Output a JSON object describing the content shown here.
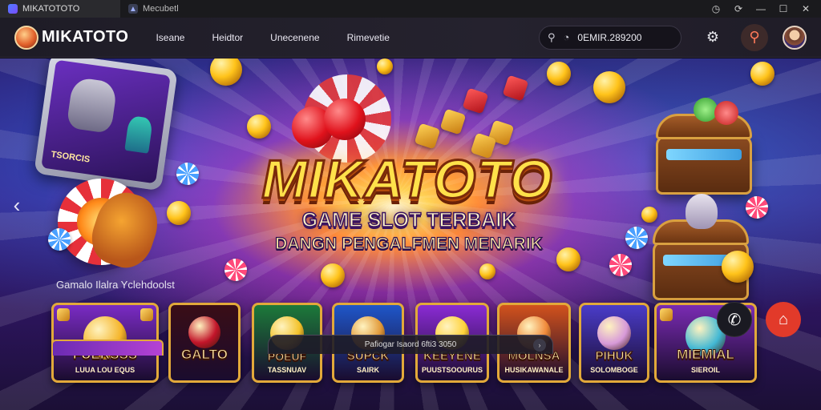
{
  "window": {
    "tabs": [
      {
        "label": "MIKATOTOTO",
        "active": true
      },
      {
        "label": "Mecubetl",
        "active": false
      }
    ],
    "controls": [
      "history-icon",
      "sync-icon",
      "minimize-icon",
      "maximize-icon",
      "close-icon"
    ]
  },
  "navbar": {
    "logo_text": "MIKATOTO",
    "links": [
      "Iseane",
      "Heidtor",
      "Unecenene",
      "Rimevetie"
    ],
    "search_value": "0EMIR.289200",
    "icons": [
      "search-icon",
      "settings-icon",
      "search-button-icon",
      "avatar"
    ]
  },
  "hero": {
    "title": "MIKATOTO",
    "subtitle": "GAME SLOT TERBAIK",
    "subtitle2": "DANGN PENGALFMEN MENARIK",
    "tablet_text": "TSORCIS",
    "section_title": "Gamalo Ilalra Yclehdoolst"
  },
  "games": [
    {
      "label": "FUERSSS",
      "sub": "LUUA LOU EQUS",
      "bg": "#7a2bc4",
      "art": "#f5b52a"
    },
    {
      "label": "GALTO",
      "sub": "",
      "bg": "#3a0d16",
      "art": "#c2152a"
    },
    {
      "label": "POEUF",
      "sub": "TASSNUAV",
      "bg": "#1c7a3a",
      "art": "#f3c22a"
    },
    {
      "label": "SUPCK",
      "sub": "SAIRK",
      "bg": "#1f56c9",
      "art": "#e29a3a"
    },
    {
      "label": "KEEYENE",
      "sub": "PUUSTSOOURUS",
      "bg": "#8a2bd4",
      "art": "#ffd23a"
    },
    {
      "label": "MOLNSA",
      "sub": "HUSIKAWANALE",
      "bg": "#d2521c",
      "art": "#f08a3a"
    },
    {
      "label": "PIHUK",
      "sub": "SOLOMBOGE",
      "bg": "#4a3cc9",
      "art": "#d79ad9"
    },
    {
      "label": "MIEMIAL",
      "sub": "SIEROIL",
      "bg": "#7a2bb3",
      "art": "#42b8d4"
    }
  ],
  "status_text": "Pafiogar Isaord 6fti3 3050",
  "colors": {
    "accent": "#ffe14a",
    "brand": "#e23a2a",
    "frame": "#e2a93a"
  }
}
